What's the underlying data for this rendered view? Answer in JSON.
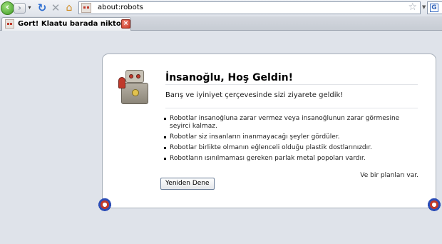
{
  "toolbar": {
    "back_icon": "back-arrow-icon",
    "forward_icon": "forward-arrow-icon",
    "dropdown_icon": "history-dropdown-icon",
    "reload_icon": "reload-icon",
    "stop_icon": "stop-icon",
    "home_icon": "home-icon",
    "url": "about:robots",
    "bookmark_icon": "bookmark-star-icon",
    "search_engine_label": "G"
  },
  "tab": {
    "title": "Gort! Klaatu barada nikto!",
    "close_label": "×"
  },
  "error_page": {
    "title": "İnsanoğlu, Hoş Geldin!",
    "short_desc": "Barış ve iyiniyet çerçevesinde sizi ziyarete geldik!",
    "rules": [
      "Robotlar insanoğluna zarar vermez veya insanoğlunun zarar görmesine seyirci kalmaz.",
      "Robotlar siz insanların inanmayacağı şeyler gördüler.",
      "Robotlar birlikte olmanın eğlenceli olduğu plastik dostlarınızdır.",
      "Robotların ısınılmaması gereken parlak metal popoları vardır."
    ],
    "plan_text": "Ve bir planları var.",
    "retry_button": "Yeniden Dene"
  },
  "colors": {
    "page_bg": "#dfe3ea",
    "box_bg": "#ffffff",
    "back_green": "#3f9b23",
    "close_red": "#c8321f"
  }
}
